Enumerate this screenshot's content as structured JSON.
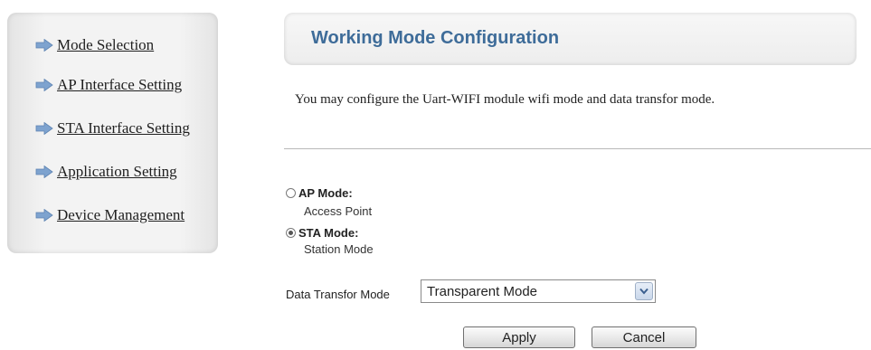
{
  "sidebar": {
    "items": [
      {
        "label": "Mode Selection"
      },
      {
        "label": "AP Interface Setting"
      },
      {
        "label": "STA Interface Setting"
      },
      {
        "label": "Application Setting"
      },
      {
        "label": "Device Management"
      }
    ]
  },
  "page": {
    "title": "Working Mode Configuration",
    "description": "You may configure the Uart-WIFI module wifi mode and data transfor mode."
  },
  "modes": {
    "ap": {
      "label": "AP Mode:",
      "sublabel": "Access Point",
      "selected": false
    },
    "sta": {
      "label": "STA Mode:",
      "sublabel": "Station Mode",
      "selected": true
    }
  },
  "data_transfer": {
    "label": "Data Transfor Mode",
    "selected": "Transparent Mode"
  },
  "buttons": {
    "apply": "Apply",
    "cancel": "Cancel"
  },
  "colors": {
    "title": "#3e6c99",
    "arrow": "#7ea3cf"
  }
}
